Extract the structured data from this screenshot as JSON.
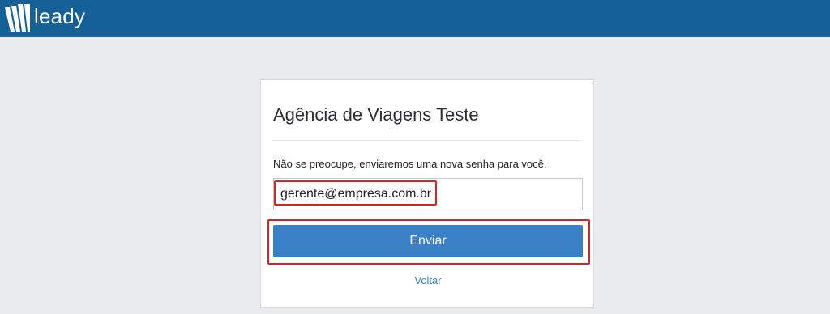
{
  "header": {
    "brand": "leady",
    "logo_icon": "leady-logo-icon",
    "background_color": "#156197"
  },
  "card": {
    "title": "Agência de Viagens Teste",
    "hint": "Não se preocupe, enviaremos uma nova senha para você.",
    "email": {
      "value": "gerente@empresa.com.br",
      "placeholder": ""
    },
    "submit_label": "Enviar",
    "back_label": "Voltar"
  },
  "colors": {
    "primary": "#3a80c7",
    "highlight": "#e02020",
    "page_background": "#ebecee"
  }
}
